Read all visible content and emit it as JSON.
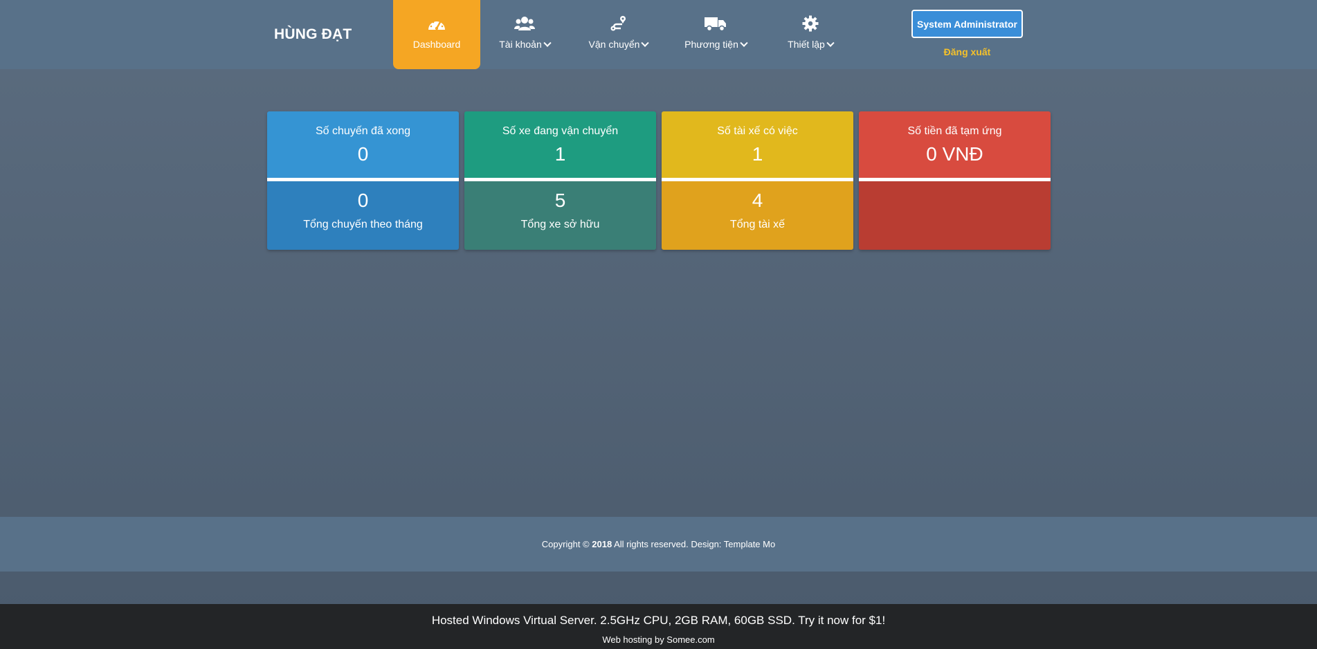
{
  "header": {
    "brand": "HÙNG ĐẠT",
    "nav": [
      {
        "label": "Dashboard",
        "icon": "speedometer-icon",
        "active": true
      },
      {
        "label": "Tài khoản",
        "icon": "users-icon",
        "active": false
      },
      {
        "label": "Vận chuyển",
        "icon": "route-icon",
        "active": false
      },
      {
        "label": "Phương tiện",
        "icon": "truck-icon",
        "active": false
      },
      {
        "label": "Thiết lập",
        "icon": "gear-icon",
        "active": false
      }
    ],
    "user_button": "System Administrator",
    "logout": "Đăng xuất"
  },
  "cards": [
    {
      "title": "Số chuyến đã xong",
      "value": "0",
      "value2": "0",
      "subtitle": "Tổng chuyến theo tháng",
      "color": "#3594d3"
    },
    {
      "title": "Số xe đang vận chuyển",
      "value": "1",
      "value2": "5",
      "subtitle": "Tổng xe sở hữu",
      "color": "#1e9c80"
    },
    {
      "title": "Số tài xế có việc",
      "value": "1",
      "value2": "4",
      "subtitle": "Tổng tài xế",
      "color": "#e1b81d"
    },
    {
      "title": "Số tiền đã tạm ứng",
      "value": "0 VNĐ",
      "value2": "",
      "subtitle": "",
      "color": "#d84b3f"
    }
  ],
  "footer": {
    "prefix": "Copyright © ",
    "year": "2018",
    "suffix": " All rights reserved. Design: Template Mo"
  },
  "hosting": {
    "line1": "Hosted Windows Virtual Server. 2.5GHz CPU, 2GB RAM, 60GB SSD. Try it now for $1!",
    "line2": "Web hosting by Somee.com"
  },
  "colors": {
    "accent": "#f5a623",
    "header_bg": "#587189",
    "user_button_bg": "#3a8ed8",
    "logout_text": "#f5c12a"
  }
}
